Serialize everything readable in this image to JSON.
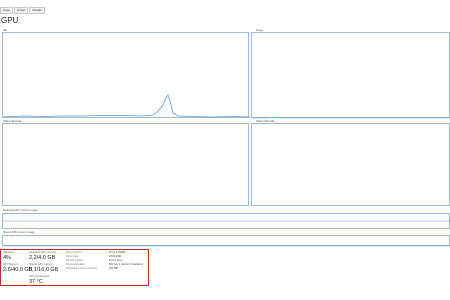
{
  "tabs": [
    "Copy",
    "Graph",
    "Details"
  ],
  "page_title": "GPU",
  "graphs": [
    {
      "label": "3D"
    },
    {
      "label": "Copy"
    },
    {
      "label": "Video Encode"
    },
    {
      "label": "Video Decode"
    }
  ],
  "memory_strips": [
    {
      "label": "Dedicated GPU memory usage"
    },
    {
      "label": "Shared GPU memory usage"
    }
  ],
  "stats": {
    "utilization": {
      "label": "Utilization",
      "value": "4%"
    },
    "dedicated_mem": {
      "label": "Dedicated GPU memory",
      "value": "2,2/4,0 GB"
    },
    "gpu_memory": {
      "label": "GPU Memory",
      "value": "2,6/40,0 GB"
    },
    "shared_mem": {
      "label": "Shared GPU memory",
      "value": "0,1/16,0 GB"
    },
    "gpu_temp": {
      "label": "GPU Temperature",
      "value": "37 °C"
    }
  },
  "details": [
    {
      "key": "Driver version:",
      "value": "27.21.14.6089"
    },
    {
      "key": "Driver date:",
      "value": "23.06.2021"
    },
    {
      "key": "DirectX version:",
      "value": "12 (FL 12.1)"
    },
    {
      "key": "Physical location:",
      "value": "PCI bus 1, device 0, function 0"
    },
    {
      "key": "Hardware reserved memory:",
      "value": "220 MB"
    }
  ],
  "colors": {
    "graph_border": "#9dbcd6",
    "graph_line": "#5b9bd5",
    "highlight_box": "#c62828"
  }
}
